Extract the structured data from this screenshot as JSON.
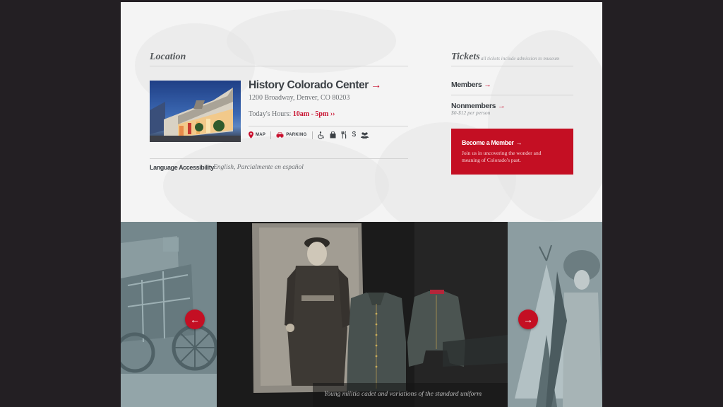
{
  "location": {
    "heading": "Location",
    "venue_name": "History Colorado Center",
    "venue_arrow": "→",
    "address": "1200 Broadway, Denver, CO 80203",
    "hours_label": "Today's Hours:",
    "hours_value": "10am - 5pm ››",
    "amenities": {
      "map_label": "MAP",
      "parking_label": "PARKING",
      "map_icon": "map-pin-icon",
      "parking_icon": "car-icon",
      "accessible_icon": "wheelchair-icon",
      "shop_icon": "shopping-bag-icon",
      "dining_icon": "utensils-icon",
      "price_icon": "dollar-icon",
      "group_icon": "group-icon",
      "price_glyph": "$"
    },
    "language_label": "Language Accessibility",
    "language_value": "English, Parcialmente en español"
  },
  "tickets": {
    "heading": "Tickets",
    "note": "all tickets include admission to museum",
    "members_label": "Members",
    "nonmembers_label": "Nonmembers",
    "nonmembers_price": "$0-$12 per person",
    "arrow": "→"
  },
  "membership": {
    "title": "Become a Member",
    "text": "Join us in uncovering the wonder and meaning of Colorado's past."
  },
  "carousel": {
    "caption": "Young militia cadet and variations of the standard uniform",
    "prev_icon": "←",
    "next_icon": "→"
  },
  "colors": {
    "accent": "#c40f23",
    "panel_bg": "#f4f4f4",
    "page_bg": "#231f23",
    "text_dark": "#3a3f44"
  }
}
